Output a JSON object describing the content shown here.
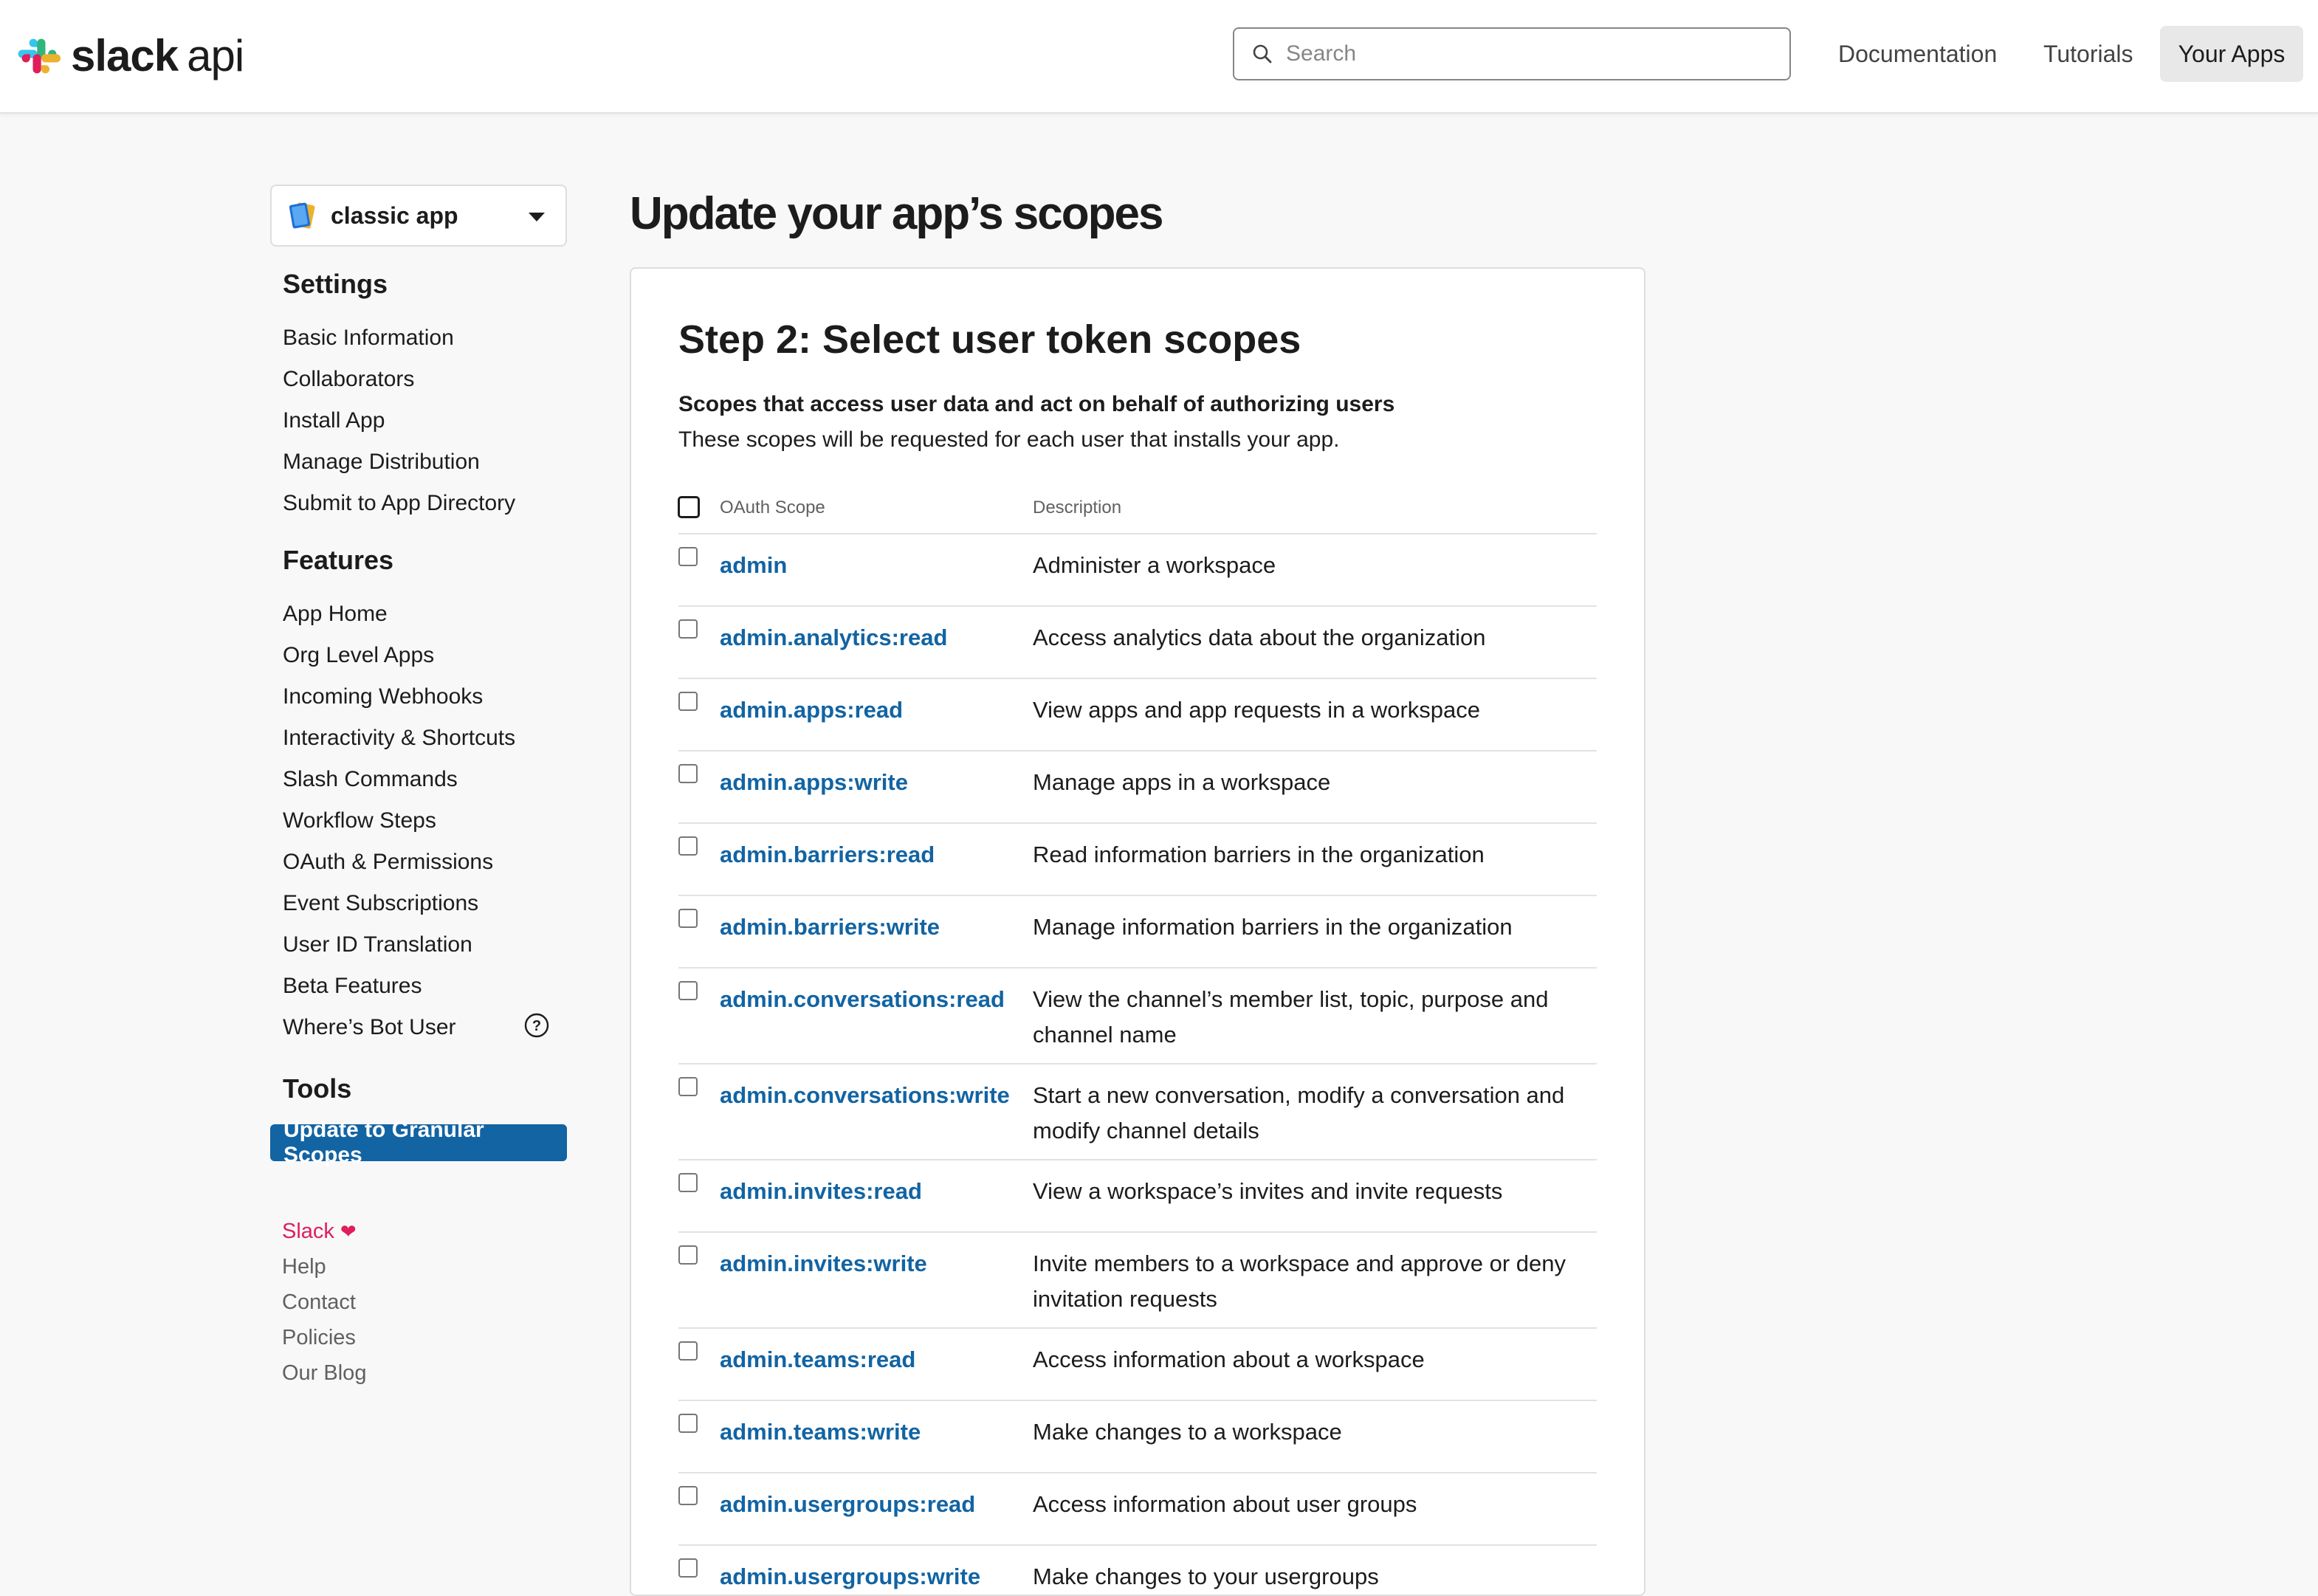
{
  "header": {
    "logo": {
      "brand": "slack",
      "product": "api"
    },
    "search": {
      "placeholder": "Search",
      "value": ""
    },
    "nav": [
      "Documentation",
      "Tutorials",
      "Your Apps"
    ],
    "active_nav": "Your Apps"
  },
  "sidebar": {
    "app_selector": {
      "name": "classic app"
    },
    "settings": {
      "heading": "Settings",
      "items": [
        "Basic Information",
        "Collaborators",
        "Install App",
        "Manage Distribution",
        "Submit to App Directory"
      ]
    },
    "features": {
      "heading": "Features",
      "items": [
        "App Home",
        "Org Level Apps",
        "Incoming Webhooks",
        "Interactivity & Shortcuts",
        "Slash Commands",
        "Workflow Steps",
        "OAuth & Permissions",
        "Event Subscriptions",
        "User ID Translation",
        "Beta Features",
        "Where’s Bot User"
      ]
    },
    "tools": {
      "heading": "Tools",
      "active_item": "Update to Granular Scopes"
    },
    "footer": [
      "Slack",
      "Help",
      "Contact",
      "Policies",
      "Our Blog"
    ]
  },
  "main": {
    "title": "Update your app’s scopes",
    "step_title": "Step 2: Select user token scopes",
    "intro_bold": "Scopes that access user data and act on behalf of authorizing users",
    "intro_text": "These scopes will be requested for each user that installs your app.",
    "table": {
      "headers": [
        "OAuth Scope",
        "Description"
      ],
      "rows": [
        {
          "scope": "admin",
          "description": "Administer a workspace"
        },
        {
          "scope": "admin.analytics:read",
          "description": "Access analytics data about the organization"
        },
        {
          "scope": "admin.apps:read",
          "description": "View apps and app requests in a workspace"
        },
        {
          "scope": "admin.apps:write",
          "description": "Manage apps in a workspace"
        },
        {
          "scope": "admin.barriers:read",
          "description": "Read information barriers in the organization"
        },
        {
          "scope": "admin.barriers:write",
          "description": "Manage information barriers in the organization"
        },
        {
          "scope": "admin.conversations:read",
          "description": "View the channel’s member list, topic, purpose and channel name"
        },
        {
          "scope": "admin.conversations:write",
          "description": "Start a new conversation, modify a conversation and modify channel details"
        },
        {
          "scope": "admin.invites:read",
          "description": "View a workspace’s invites and invite requests"
        },
        {
          "scope": "admin.invites:write",
          "description": "Invite members to a workspace and approve or deny invitation requests"
        },
        {
          "scope": "admin.teams:read",
          "description": "Access information about a workspace"
        },
        {
          "scope": "admin.teams:write",
          "description": "Make changes to a workspace"
        },
        {
          "scope": "admin.usergroups:read",
          "description": "Access information about user groups"
        },
        {
          "scope": "admin.usergroups:write",
          "description": "Make changes to your usergroups"
        }
      ]
    }
  },
  "colors": {
    "link": "#1264a3",
    "active_button": "#1264a3",
    "slack_brand": "#e01e5a",
    "background": "#f8f8f8"
  }
}
